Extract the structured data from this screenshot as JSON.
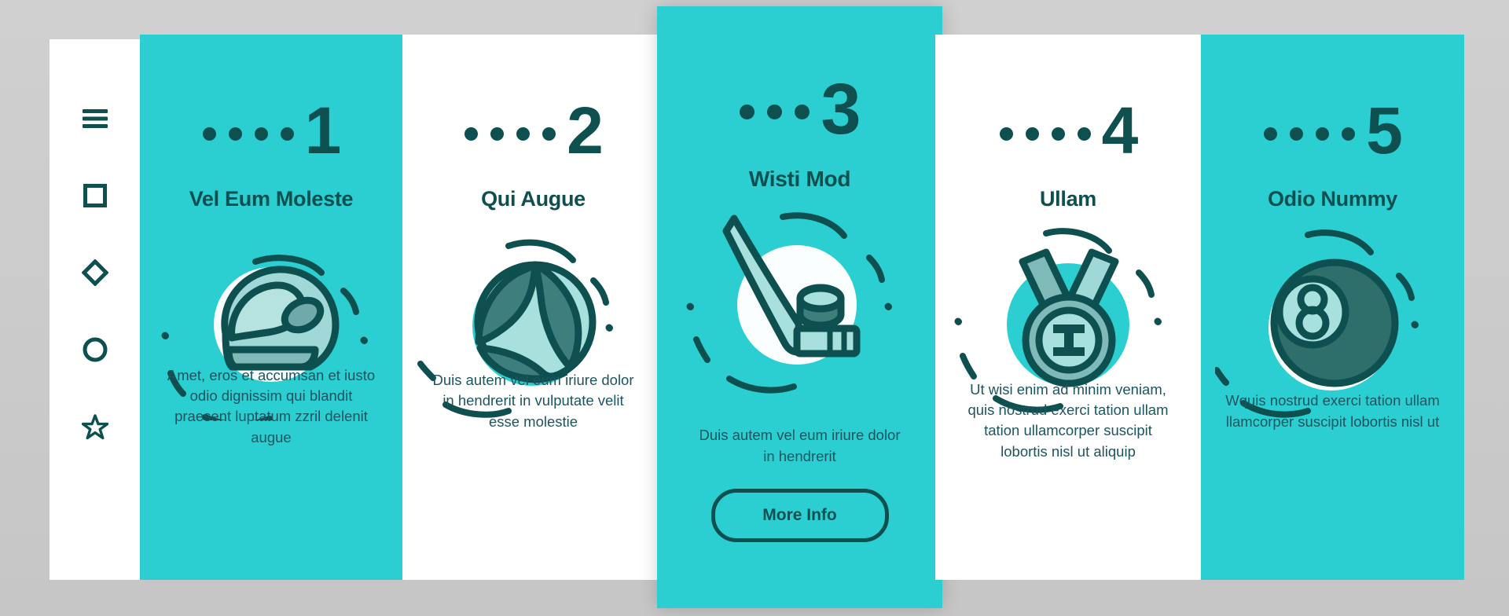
{
  "colors": {
    "teal": "#2BCFD1",
    "dark_teal": "#0E4F4F",
    "body_text": "#1C5560",
    "white": "#FFFFFF",
    "page_bg": "#C9C9C9",
    "light_mint": "#A8E0DE",
    "mid_teal": "#3D8B87"
  },
  "sidebar": {
    "items": [
      {
        "icon": "hamburger-menu-icon",
        "label": "Menu"
      },
      {
        "icon": "square-icon",
        "label": "Square"
      },
      {
        "icon": "diamond-icon",
        "label": "Diamond"
      },
      {
        "icon": "circle-icon",
        "label": "Circle"
      },
      {
        "icon": "star-icon",
        "label": "Star"
      }
    ]
  },
  "cards": [
    {
      "number": "1",
      "dots": 4,
      "title": "Vel Eum Moleste",
      "body": "Amet, eros et accumsan et iusto odio dignissim qui blandit praesent luptatum zzril delenit augue",
      "illustration": "racing-helmet-icon",
      "theme": "teal",
      "button": null
    },
    {
      "number": "2",
      "dots": 4,
      "title": "Qui Augue",
      "body": "Duis autem vel eum iriure dolor in hendrerit in vulputate velit esse molestie",
      "illustration": "volleyball-icon",
      "theme": "white",
      "button": null
    },
    {
      "number": "3",
      "dots": 3,
      "title": "Wisti Mod",
      "body": "Duis autem vel eum iriure dolor in hendrerit",
      "illustration": "hockey-stick-puck-icon",
      "theme": "teal",
      "button": "More Info"
    },
    {
      "number": "4",
      "dots": 4,
      "title": "Ullam",
      "body": "Ut wisi enim ad minim veniam, quis nostrud exerci tation ullam tation ullamcorper suscipit lobortis nisl ut aliquip",
      "illustration": "medal-icon",
      "theme": "white",
      "button": null
    },
    {
      "number": "5",
      "dots": 4,
      "title": "Odio Nummy",
      "body": "Wquis nostrud exerci tation ullam llamcorper suscipit lobortis nisl ut",
      "illustration": "billiard-eight-ball-icon",
      "theme": "teal",
      "button": null
    }
  ]
}
